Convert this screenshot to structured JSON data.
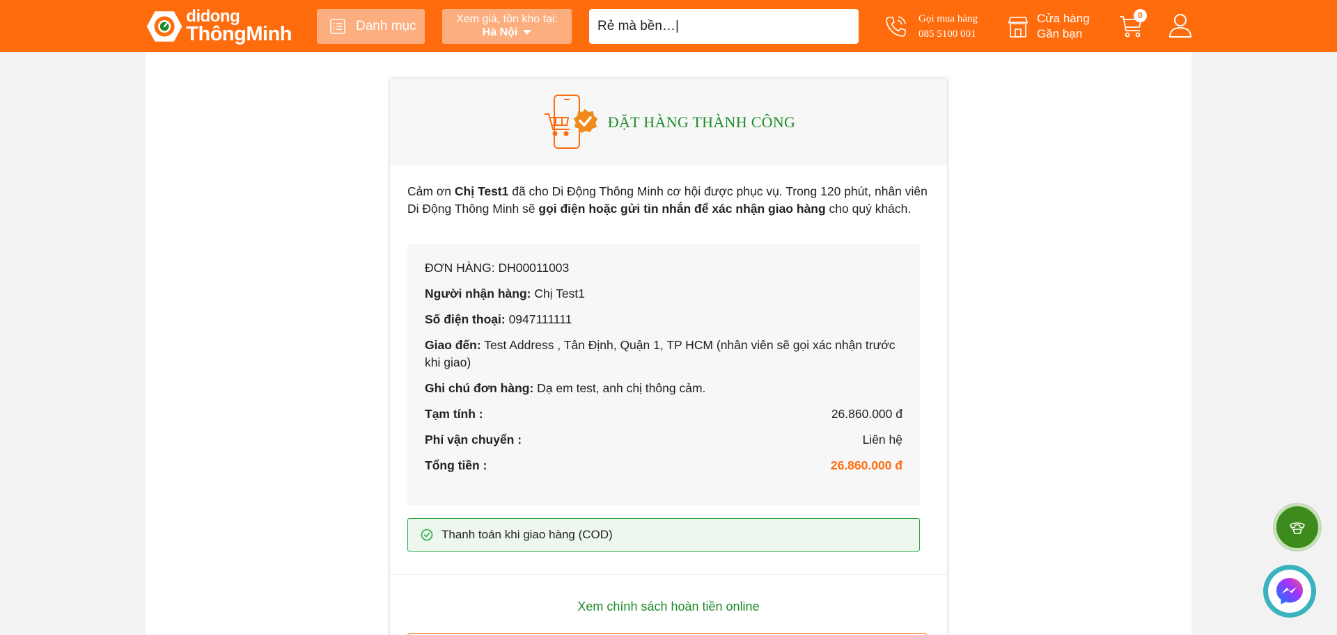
{
  "header": {
    "logo": {
      "line1": "didong",
      "line2": "ThôngMinh"
    },
    "menu_button": {
      "label": "Danh mục",
      "icon": "list-icon"
    },
    "location": {
      "label": "Xem giá, tồn kho tại:",
      "city": "Hà Nội"
    },
    "search": {
      "value": "Rẻ mà bền…|"
    },
    "hotline": {
      "label": "Gọi mua hàng",
      "phone": "085 5100 001",
      "icon": "phone-icon"
    },
    "store": {
      "line1": "Cửa hàng",
      "line2": "Gần bạn",
      "icon": "store-icon"
    },
    "cart": {
      "count": "0",
      "icon": "cart-icon"
    },
    "account": {
      "icon": "user-icon"
    },
    "colors": {
      "brand": "#ff6c0e",
      "button_bg": "#fcae7f"
    }
  },
  "success": {
    "title": "ĐẶT HÀNG THÀNH CÔNG",
    "icon": "phone-cart-check-icon"
  },
  "thanks": {
    "p1": "Cảm ơn ",
    "customer": "Chị Test1",
    "p2": " đã cho Di Động Thông Minh cơ hội được phục vụ. Trong 120 phút, nhân viên Di Động Thông Minh sẽ ",
    "bold2": "gọi điện hoặc gửi tin nhắn để xác nhận giao hàng",
    "p3": " cho quý khách."
  },
  "order": {
    "code_label": "ĐƠN HÀNG: ",
    "code": "DH00011003",
    "receiver_label": "Người nhận hàng:",
    "receiver": " Chị Test1",
    "phone_label": "Số điện thoại:",
    "phone": " 0947111111",
    "address_label": "Giao đến:",
    "address": " Test Address , Tân Định, Quận 1, TP HCM (nhân viên sẽ gọi xác nhận trước khi giao)",
    "note_label": "Ghi chú đơn hàng:",
    "note": " Dạ em test, anh chị thông cảm.",
    "subtotal_label": "Tạm tính :",
    "subtotal": "26.860.000 đ",
    "shipping_label": "Phí vận chuyển :",
    "shipping": "Liên hệ",
    "total_label": "Tổng tiền :",
    "total": "26.860.000 đ",
    "total_color": "#ff6c0e"
  },
  "payment": {
    "label": "Thanh toán khi giao hàng (COD)",
    "icon": "check-circle-icon",
    "color": "#27a844"
  },
  "refund_link": "Xem chính sách hoàn tiền online",
  "floating": {
    "call_icon": "phone-call-icon",
    "messenger_icon": "messenger-icon"
  }
}
